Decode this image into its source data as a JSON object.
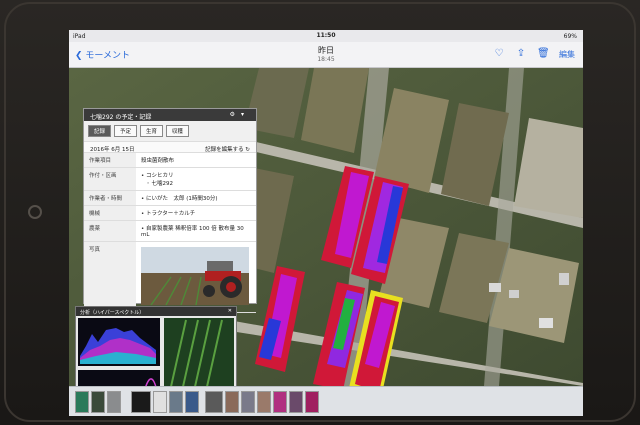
{
  "status_bar": {
    "carrier": "iPad",
    "time": "11:50",
    "battery": "69%"
  },
  "nav": {
    "back_label": "モーメント",
    "title": "昨日",
    "subtitle": "18:45",
    "edit_label": "編集",
    "icons": [
      "heart-icon",
      "share-icon",
      "trash-icon"
    ]
  },
  "record_panel": {
    "title": "七噛292 の予定・記録",
    "tabs": [
      "記録",
      "予定",
      "生育",
      "収穫"
    ],
    "active_tab": "記録",
    "date": "2016年 6月 15日",
    "edit_label": "記録を編集する",
    "rows": [
      {
        "key": "作業項目",
        "value": "殺虫菌剤散布"
      },
      {
        "key": "作付・区画",
        "value": "• コシヒカリ\n　◦ 七噛292"
      },
      {
        "key": "作業者・時間",
        "value": "• にいがた　太郎 (1時間30分)"
      },
      {
        "key": "機械",
        "value": "• トラクター＋カルチ"
      },
      {
        "key": "農薬",
        "value": "• 自家製農薬 稀釈倍率 100 倍 散布量 30 mL"
      },
      {
        "key": "写真",
        "value": ""
      }
    ]
  },
  "analysis_panel": {
    "title": "分析（ハイパースペクトル）"
  },
  "colors": {
    "accent": "#2a6ad9",
    "panel_header": "#3a3a3a"
  }
}
